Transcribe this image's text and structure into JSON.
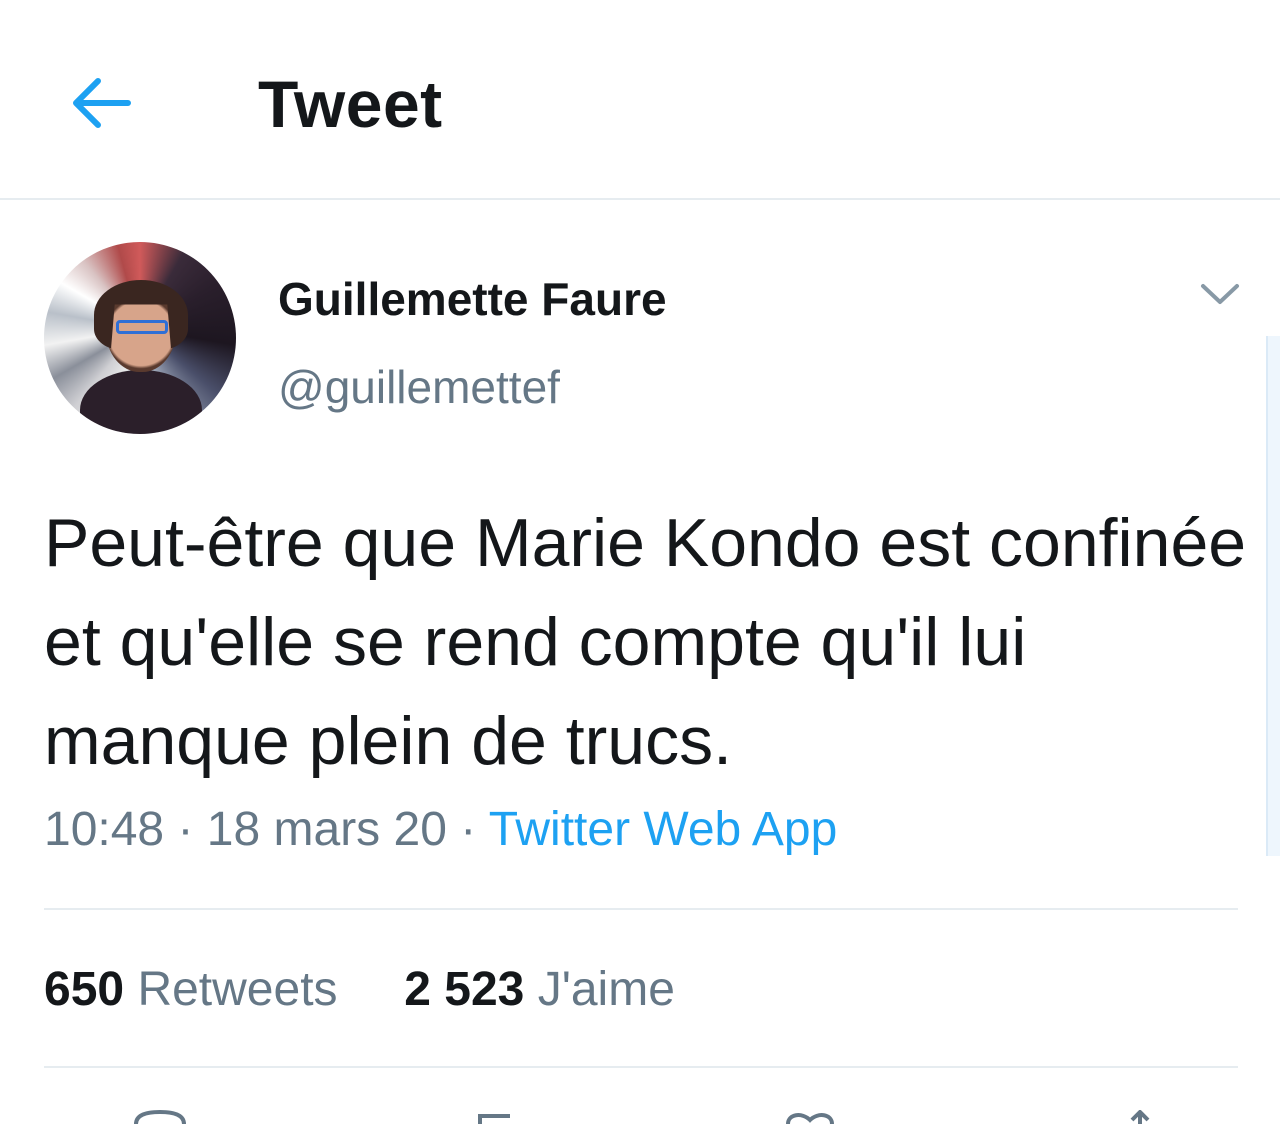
{
  "header": {
    "back_icon": "arrow-left-icon",
    "title": "Tweet"
  },
  "author": {
    "name": "Guillemette Faure",
    "handle": "@guillemettef",
    "menu_icon": "chevron-down-icon"
  },
  "tweet": {
    "text": "Peut-être que Marie Kondo est confinée et qu'elle se rend compte qu'il lui manque plein de trucs.",
    "time": "10:48",
    "separator": " · ",
    "date": "18 mars 20",
    "source": "Twitter Web App"
  },
  "stats": {
    "retweets_count": "650",
    "retweets_label": "Retweets",
    "likes_count": "2 523",
    "likes_label": "J'aime"
  },
  "actions": [
    "reply-icon",
    "retweet-icon",
    "like-icon",
    "share-icon"
  ],
  "colors": {
    "accent": "#1da1f2",
    "text": "#14171a",
    "secondary": "#657786",
    "divider": "#e6ecf0"
  }
}
